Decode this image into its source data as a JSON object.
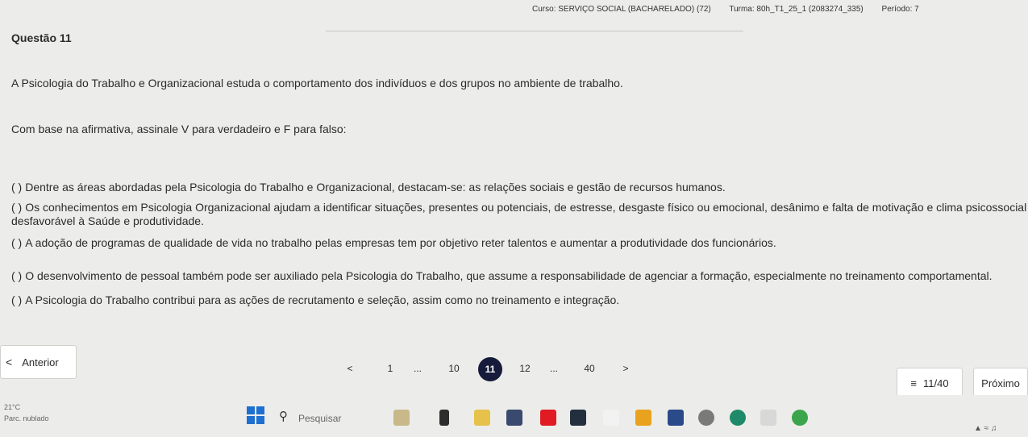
{
  "header": {
    "curso": "Curso: SERVIÇO SOCIAL (BACHARELADO) (72)",
    "turma": "Turma: 80h_T1_25_1 (2083274_335)",
    "periodo": "Período: 7"
  },
  "question": {
    "title": "Questão 11",
    "statement": "A Psicologia do Trabalho e Organizacional estuda o comportamento dos indivíduos e dos grupos no ambiente de trabalho.",
    "instruction": "Com base na afirmativa, assinale V para verdadeiro e F para falso:",
    "options": [
      "Dentre as áreas abordadas pela Psicologia do Trabalho e Organizacional, destacam-se: as relações sociais e gestão de recursos humanos.",
      "Os conhecimentos em Psicologia Organizacional ajudam a identificar situações, presentes ou potenciais, de estresse, desgaste físico ou emocional, desânimo e falta de motivação e clima psicossocial desfavorável à Saúde e produtividade.",
      "A adoção de programas de qualidade de vida no trabalho pelas empresas tem por objetivo reter talentos e aumentar a produtividade dos funcionários.",
      "O desenvolvimento de pessoal também pode ser auxiliado pela Psicologia do Trabalho, que assume a responsabilidade de agenciar a formação, especialmente no treinamento comportamental.",
      "A Psicologia do Trabalho contribui para as ações de recrutamento e seleção, assim como no treinamento e integração."
    ],
    "paren": "( )"
  },
  "nav": {
    "prev_label": "Anterior",
    "next_label": "Próximo",
    "count_label": "11/40",
    "pages": {
      "prev": "<",
      "p1": "1",
      "dots1": "...",
      "p10": "10",
      "p11": "11",
      "p12": "12",
      "dots2": "...",
      "p40": "40",
      "next": ">"
    }
  },
  "taskbar": {
    "weather_temp": "21°C",
    "weather_desc": "Parc. nublado",
    "search_placeholder": "Pesquisar"
  }
}
